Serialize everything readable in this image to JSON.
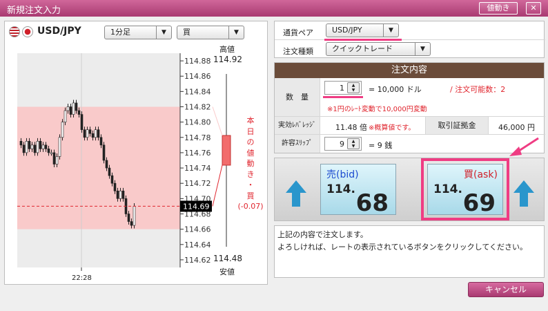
{
  "window": {
    "title": "新規注文入力",
    "price_move_button": "値動き",
    "close_glyph": "✕"
  },
  "left": {
    "symbol": "USD/JPY",
    "period": "1分足",
    "side_select": "買",
    "high_label": "高値",
    "high_value": "114.92",
    "low_label": "安値",
    "low_value": "114.48",
    "range_text": [
      "本",
      "日",
      "の",
      "値",
      "動",
      "き",
      "・",
      "買",
      "(-0.07)"
    ],
    "current_price": "114.69",
    "time_label": "22:28"
  },
  "chart_data": {
    "type": "candlestick",
    "y_ticks": [
      "114.88",
      "114.86",
      "114.84",
      "114.82",
      "114.80",
      "114.78",
      "114.76",
      "114.74",
      "114.72",
      "114.70",
      "114.68",
      "114.66",
      "114.64",
      "114.62"
    ],
    "ylim": [
      114.61,
      114.89
    ],
    "x_tick": "22:28",
    "current": 114.69,
    "closes": [
      114.77,
      114.76,
      114.775,
      114.765,
      114.77,
      114.76,
      114.775,
      114.765,
      114.77,
      114.765,
      114.76,
      114.76,
      114.745,
      114.755,
      114.78,
      114.8,
      114.815,
      114.82,
      114.81,
      114.825,
      114.815,
      114.81,
      114.79,
      114.78,
      114.79,
      114.785,
      114.78,
      114.79,
      114.78,
      114.77,
      114.75,
      114.74,
      114.73,
      114.72,
      114.71,
      114.7,
      114.71,
      114.7,
      114.68,
      114.67,
      114.665,
      114.69
    ],
    "band": [
      114.66,
      114.82
    ]
  },
  "form": {
    "pair_label": "通貨ペア",
    "pair_value": "USD/JPY",
    "type_label": "注文種類",
    "type_value": "クイックトレード",
    "header": "注文内容",
    "qty_label": "数　量",
    "qty_value": "1",
    "qty_unit": "= 10,000 ドル",
    "qty_avail": "/ 注文可能数：2",
    "qty_note": "※1円のﾚｰﾄ変動で10,000円変動",
    "leverage_label": "実効ﾚﾊﾞﾚｯｼﾞ",
    "leverage_value": "11.48 倍",
    "leverage_note": "※概算値です。",
    "margin_label": "取引証拠金",
    "margin_value": "46,000 円",
    "slip_label": "許容ｽﾘｯﾌﾟ",
    "slip_value": "9",
    "slip_unit": "= 9 銭"
  },
  "quotes": {
    "bid_label": "売(bid)",
    "bid_big": "114.",
    "bid_small": "68",
    "ask_label": "買(ask)",
    "ask_big": "114.",
    "ask_small": "69"
  },
  "message": {
    "line1": "上記の内容で注文します。",
    "line2": "よろしければ、レートの表示されているボタンをクリックしてください。"
  },
  "cancel_button": "キャンセル",
  "colors": {
    "accent": "#c23d7c",
    "red": "#e0252e",
    "highlight": "#ef3c83"
  }
}
